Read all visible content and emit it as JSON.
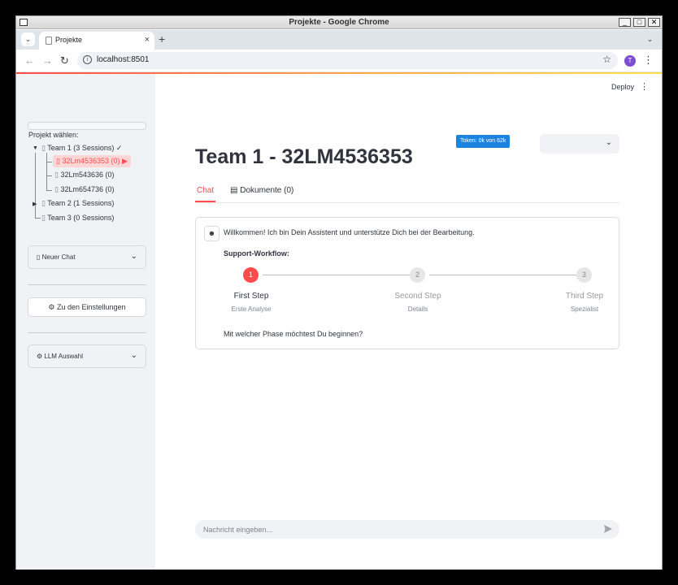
{
  "window": {
    "title": "Projekte - Google Chrome"
  },
  "browser": {
    "tab_title": "Projekte",
    "url": "localhost:8501",
    "profile_initial": "T"
  },
  "header": {
    "deploy_label": "Deploy"
  },
  "sidebar": {
    "project_label": "Projekt wählen:",
    "tree": {
      "team1": "Team 1 (3 Sessions) ✓",
      "session_selected": "32Lm4536353 (0) ▶",
      "session2": "32Lm543636 (0)",
      "session3": "32Lm654736 (0)",
      "team2": "Team 2 (1 Sessions)",
      "team3": "Team 3 (0 Sessions)"
    },
    "new_chat_label": "Neuer Chat",
    "settings_button": "⚙ Zu den Einstellungen",
    "llm_label": "⚙ LLM Auswahl"
  },
  "main": {
    "token_badge": "Token: 0k von 62k",
    "title": "Team 1 - 32LM4536353",
    "tabs": {
      "chat": "Chat",
      "docs": "Dokumente (0)"
    },
    "message": {
      "welcome": "Willkommen! Ich bin Dein Assistent und unterstütze Dich bei der Bearbeitung.",
      "workflow_title": "Support-Workflow:",
      "steps": [
        {
          "num": "1",
          "title": "First Step",
          "sub": "Erste Analyse",
          "active": true
        },
        {
          "num": "2",
          "title": "Second Step",
          "sub": "Details",
          "active": false
        },
        {
          "num": "3",
          "title": "Third Step",
          "sub": "Spezialist",
          "active": false
        }
      ],
      "question": "Mit welcher Phase möchtest Du beginnen?"
    },
    "chat_input": {
      "placeholder": "Nachricht eingeben..."
    }
  },
  "colors": {
    "accent": "#ff4b4b",
    "badge_blue": "#1c83e1",
    "sidebar_bg": "#f0f2f6",
    "text": "#31333f"
  }
}
